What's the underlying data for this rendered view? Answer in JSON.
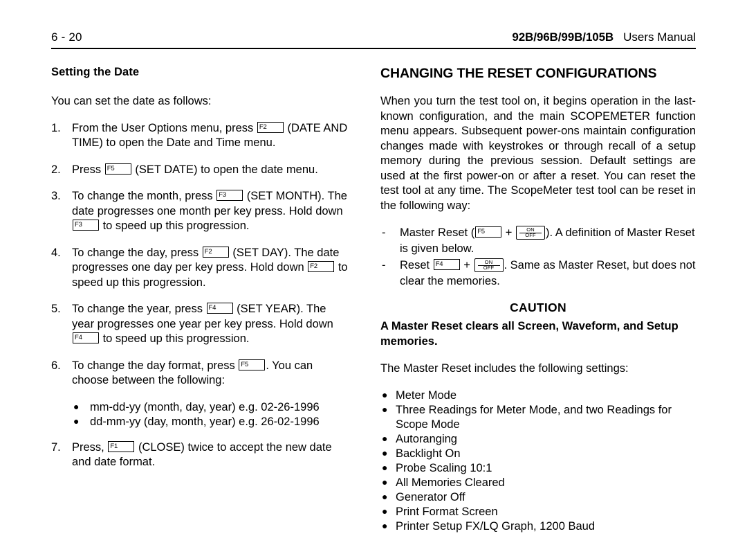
{
  "header": {
    "page_number": "6 - 20",
    "model_list": "92B/96B/99B/105B",
    "manual_title": "Users Manual"
  },
  "left_column": {
    "section_heading": "Setting the Date",
    "intro": "You can set the date as follows:",
    "steps": [
      {
        "num": "1.",
        "parts": [
          {
            "type": "text",
            "text": "From the User Options menu, press "
          },
          {
            "type": "key",
            "label": "F2"
          },
          {
            "type": "text",
            "text": " (DATE AND TIME) to open the Date and Time menu."
          }
        ]
      },
      {
        "num": "2.",
        "parts": [
          {
            "type": "text",
            "text": "Press "
          },
          {
            "type": "key",
            "label": "F5"
          },
          {
            "type": "text",
            "text": " (SET DATE) to open the date menu."
          }
        ]
      },
      {
        "num": "3.",
        "parts": [
          {
            "type": "text",
            "text": "To change the month, press "
          },
          {
            "type": "key",
            "label": "F3"
          },
          {
            "type": "text",
            "text": " (SET MONTH). The date progresses one month per key press. Hold down "
          },
          {
            "type": "key",
            "label": "F3"
          },
          {
            "type": "text",
            "text": " to speed up this progression."
          }
        ]
      },
      {
        "num": "4.",
        "parts": [
          {
            "type": "text",
            "text": "To change the day, press "
          },
          {
            "type": "key",
            "label": "F2"
          },
          {
            "type": "text",
            "text": " (SET DAY). The date progresses one day per key press. Hold down "
          },
          {
            "type": "key",
            "label": "F2"
          },
          {
            "type": "text",
            "text": " to speed up this progression."
          }
        ]
      },
      {
        "num": "5.",
        "parts": [
          {
            "type": "text",
            "text": "To change the year, press "
          },
          {
            "type": "key",
            "label": "F4"
          },
          {
            "type": "text",
            "text": " (SET YEAR). The year progresses one year per key press. Hold down "
          },
          {
            "type": "key",
            "label": "F4"
          },
          {
            "type": "text",
            "text": " to speed up this progression."
          }
        ]
      },
      {
        "num": "6.",
        "parts": [
          {
            "type": "text",
            "text": "To change the day format, press "
          },
          {
            "type": "key",
            "label": "F5"
          },
          {
            "type": "text",
            "text": ". You can choose between the following:"
          }
        ]
      },
      {
        "num": "7.",
        "parts": [
          {
            "type": "text",
            "text": "Press, "
          },
          {
            "type": "key",
            "label": "F1"
          },
          {
            "type": "text",
            "text": " (CLOSE) twice to accept the new date and date format."
          }
        ]
      }
    ],
    "date_formats": [
      "mm-dd-yy (month, day, year)  e.g. 02-26-1996",
      "dd-mm-yy (day, month, year)  e.g. 26-02-1996"
    ]
  },
  "right_column": {
    "chapter_heading": "CHANGING THE RESET CONFIGURATIONS",
    "intro_paragraph": "When you turn the test tool on, it begins operation in the last-known configuration, and the main SCOPEMETER function menu appears. Subsequent power-ons maintain configuration changes made with keystrokes or through recall of a setup memory during the previous session. Default settings are used at the first power-on or after a reset. You can reset the test tool at any time. The ScopeMeter test tool can be reset in the following way:",
    "reset_items": [
      {
        "dash": "-",
        "parts": [
          {
            "type": "text",
            "text": "Master Reset ("
          },
          {
            "type": "key",
            "label": "F5"
          },
          {
            "type": "text",
            "text": " + "
          },
          {
            "type": "key_onoff",
            "on": "ON",
            "off": "OFF"
          },
          {
            "type": "text",
            "text": "). A definition of Master Reset is given below."
          }
        ]
      },
      {
        "dash": "-",
        "parts": [
          {
            "type": "text",
            "text": "Reset "
          },
          {
            "type": "key",
            "label": "F4"
          },
          {
            "type": "text",
            "text": " + "
          },
          {
            "type": "key_onoff",
            "on": "ON",
            "off": "OFF"
          },
          {
            "type": "text",
            "text": ". Same as Master Reset, but does not clear the memories."
          }
        ]
      }
    ],
    "caution_title": "CAUTION",
    "caution_text": "A Master Reset clears all Screen, Waveform, and Setup memories.",
    "reset_intro": "The Master Reset includes the following settings:",
    "reset_settings": [
      "Meter Mode",
      "Three Readings for Meter Mode, and two Readings for Scope Mode",
      "Autoranging",
      "Backlight On",
      "Probe Scaling 10:1",
      "All Memories Cleared",
      "Generator Off",
      "Print Format Screen",
      "Printer Setup FX/LQ Graph, 1200 Baud"
    ]
  }
}
